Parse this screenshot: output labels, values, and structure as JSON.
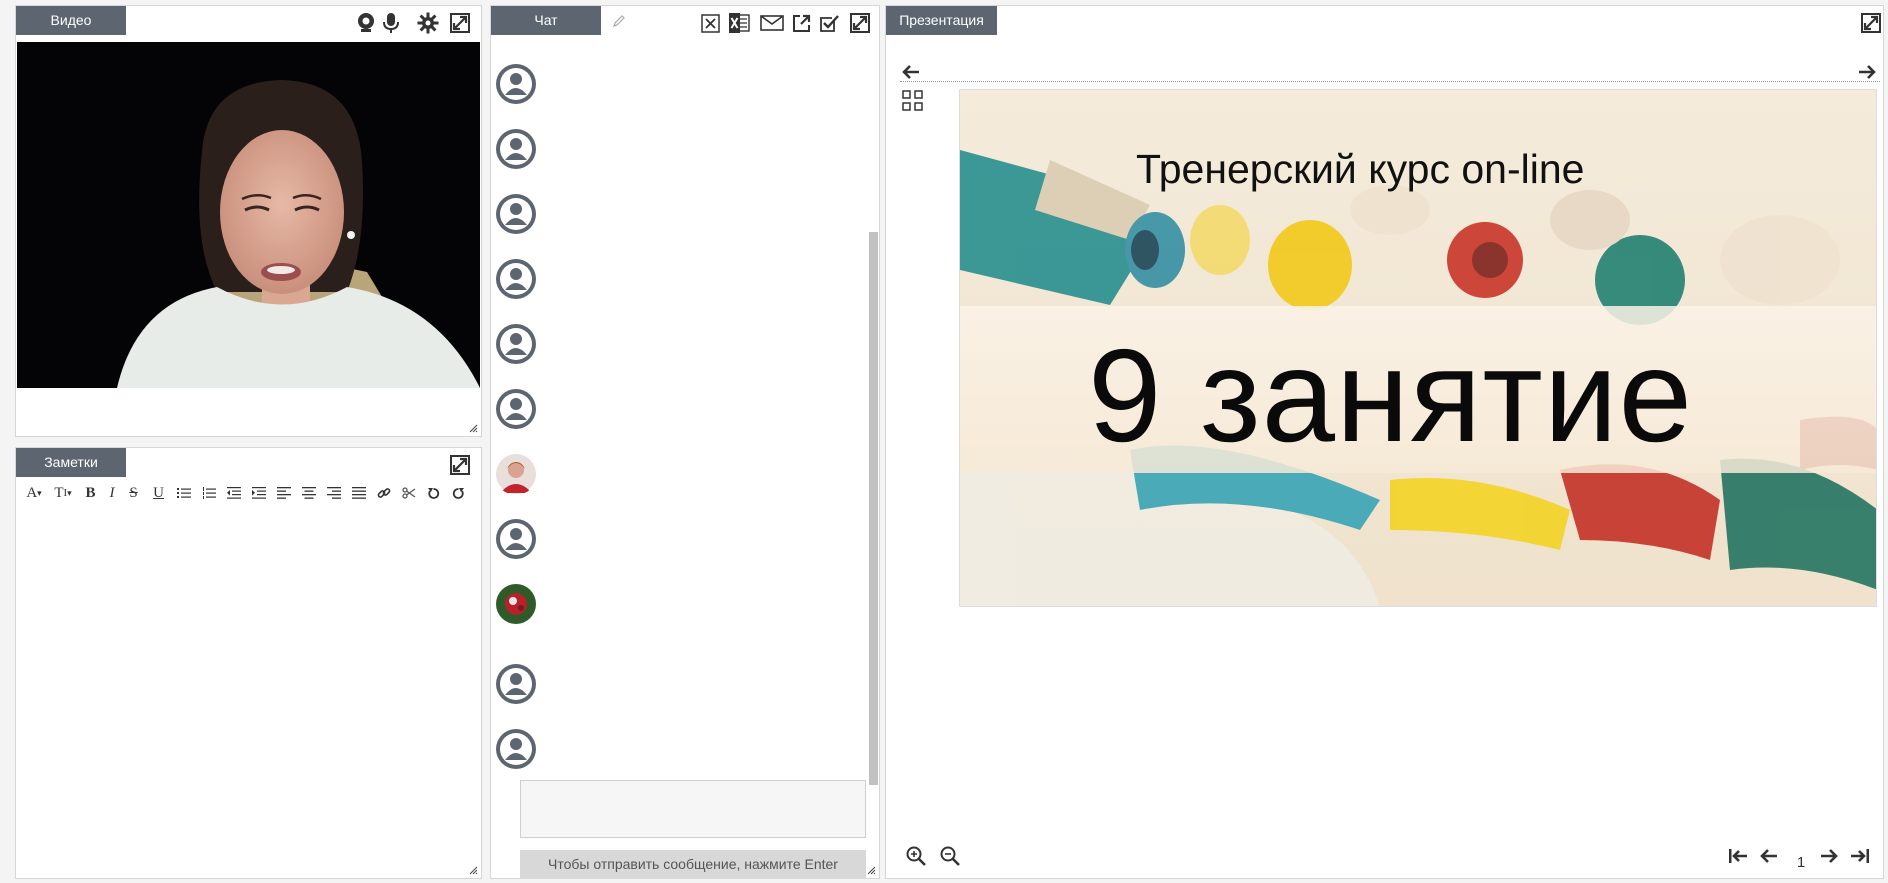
{
  "video": {
    "tab_label": "Видео"
  },
  "notes": {
    "tab_label": "Заметки"
  },
  "chat": {
    "tab_label": "Чат",
    "send_hint": "Чтобы отправить сообщение, нажмите Enter",
    "message_count": 11
  },
  "presentation": {
    "tab_label": "Презентация",
    "slide_title": "Тренерский курс on-line",
    "slide_heading": "9 занятие",
    "current_page": "1"
  },
  "colors": {
    "tab_background": "#5c6570",
    "icon": "#333333",
    "avatar_placeholder": "#5c6570"
  }
}
